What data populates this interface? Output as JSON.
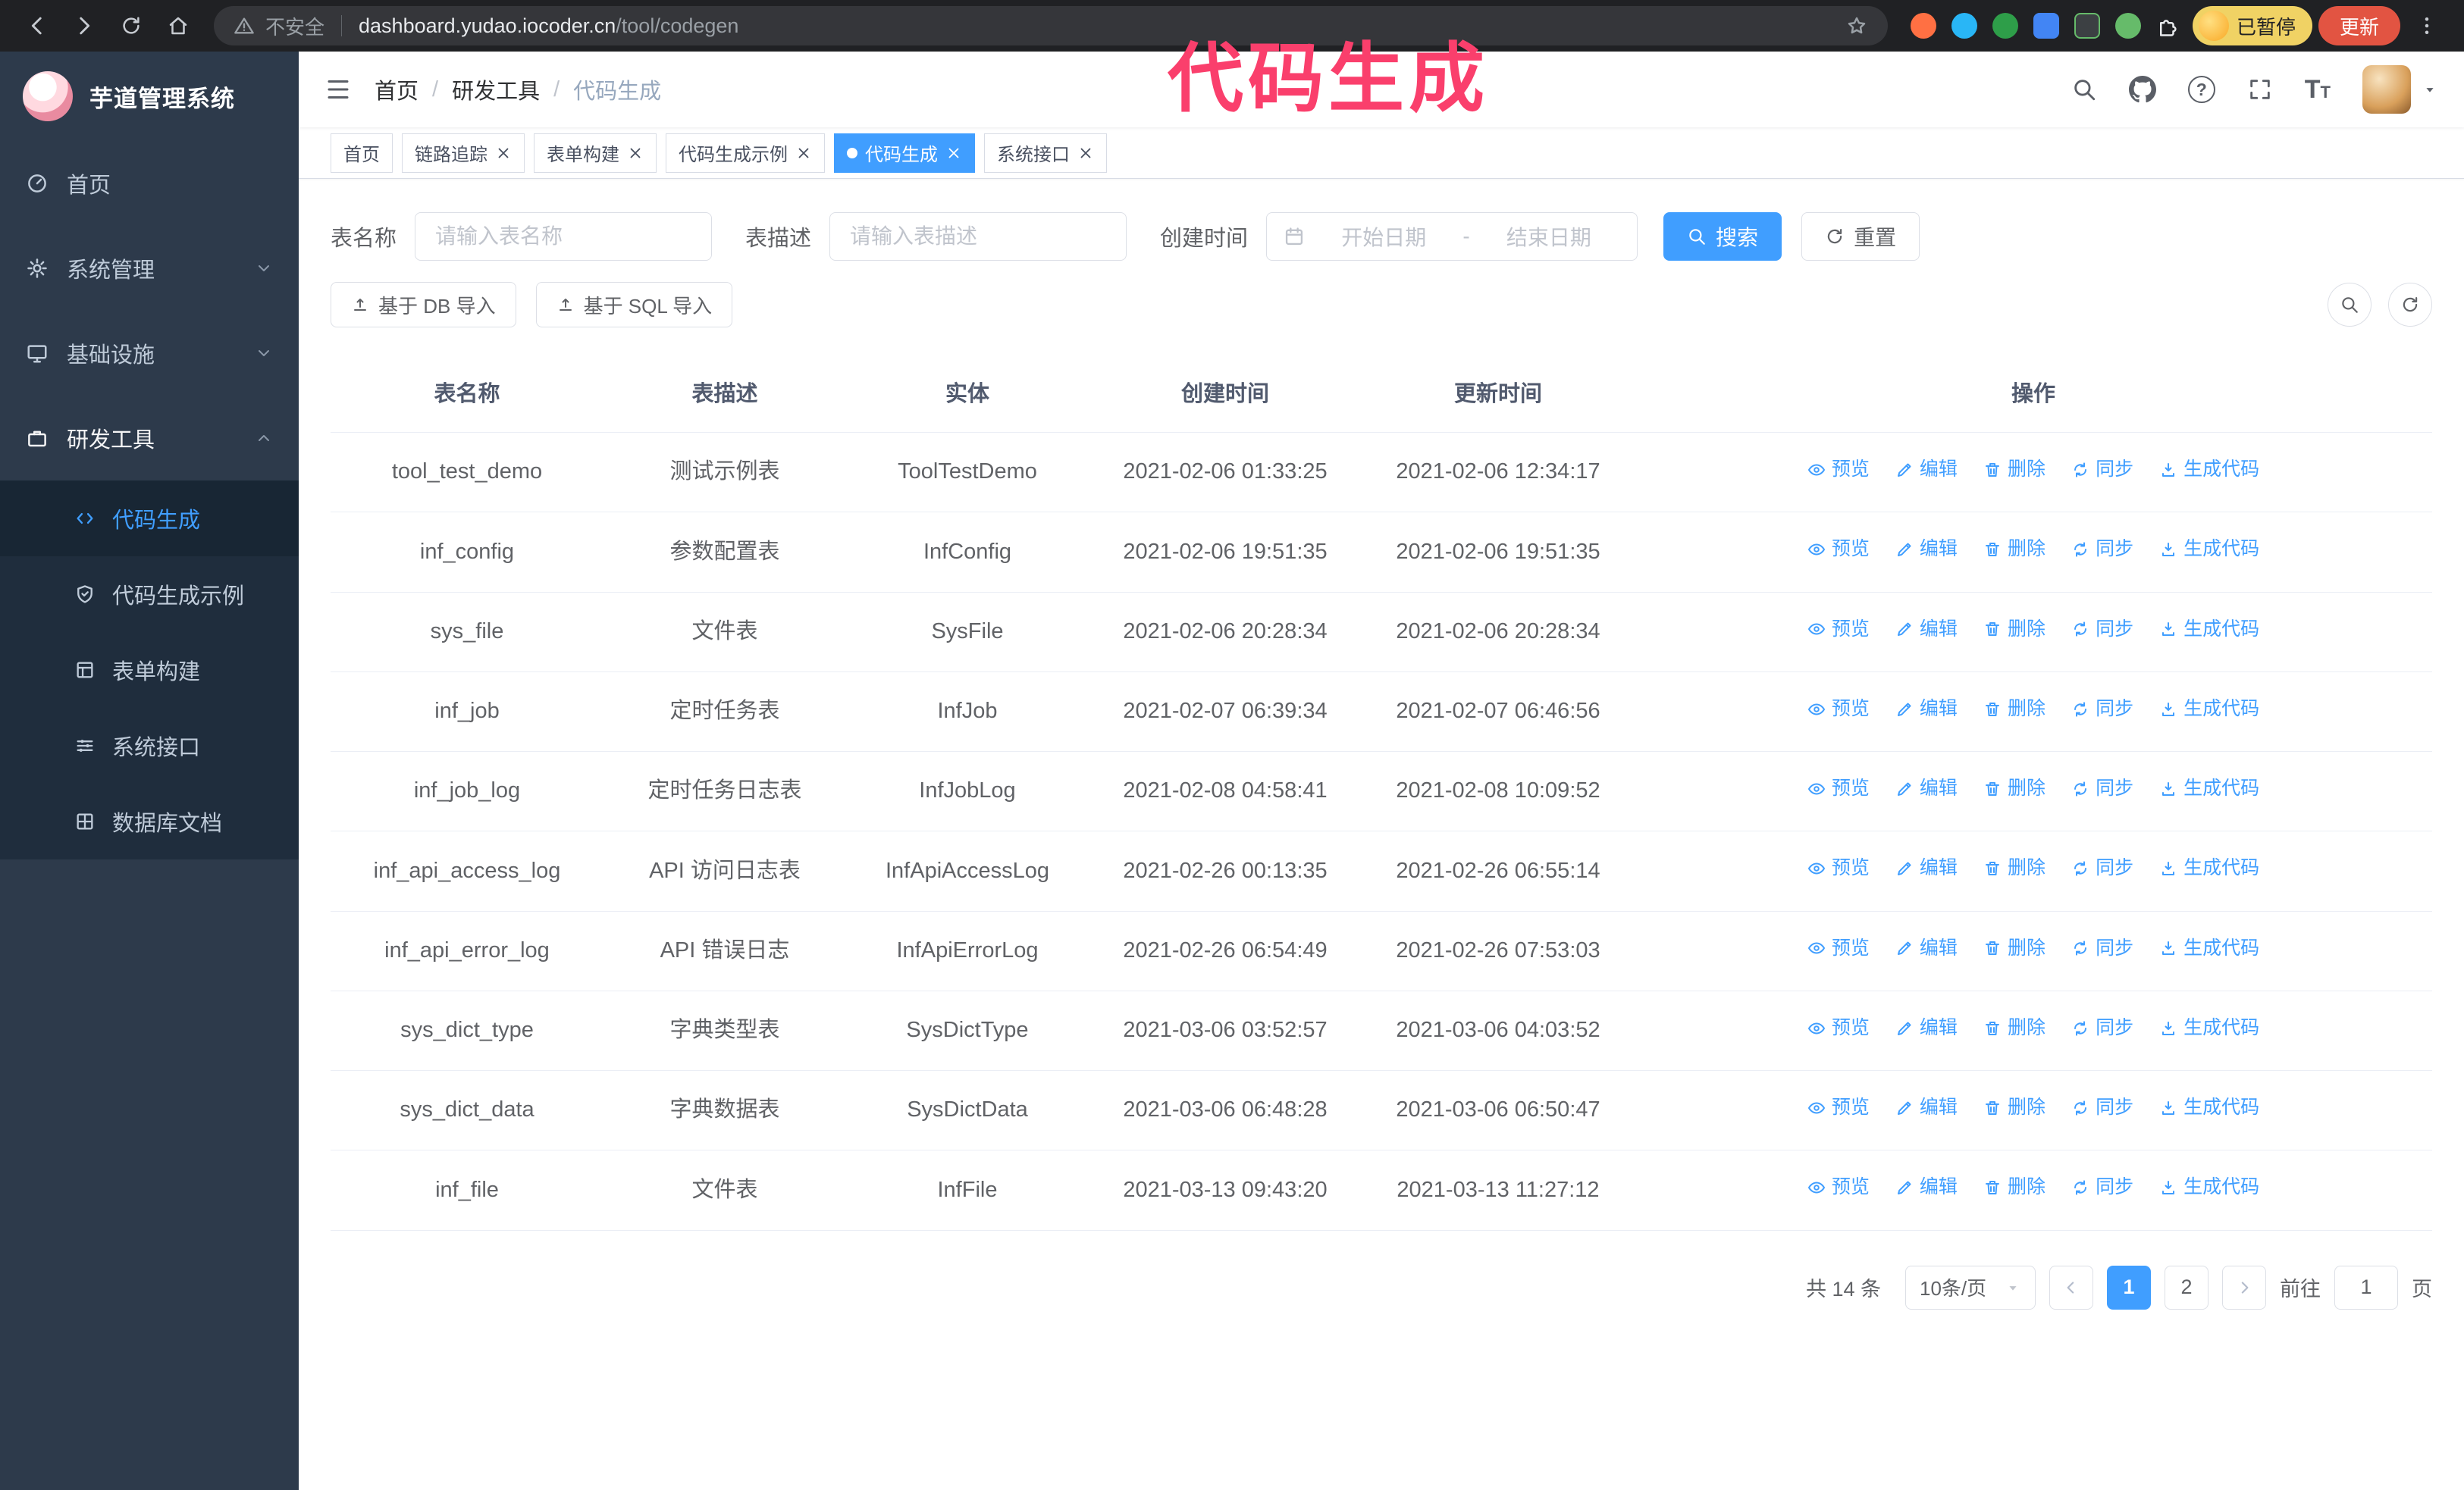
{
  "annotation": {
    "text": "代码生成"
  },
  "colors": {
    "primary_blue": "#409eff",
    "sidebar_bg": "#2d3a4b",
    "annotation_pink": "#fa3f6c",
    "update_button_red": "#e25442",
    "paused_chip_yellow": "#f0d264"
  },
  "browser": {
    "security_label": "不安全",
    "url_host": "dashboard.yudao.iocoder.cn",
    "url_path": "/tool/codegen",
    "paused_chip": "已暂停",
    "update_button": "更新"
  },
  "sidebar": {
    "logo_title": "芋道管理系统",
    "items": [
      {
        "label": "首页"
      },
      {
        "label": "系统管理"
      },
      {
        "label": "基础设施"
      },
      {
        "label": "研发工具"
      }
    ],
    "sub_items": [
      {
        "label": "代码生成"
      },
      {
        "label": "代码生成示例"
      },
      {
        "label": "表单构建"
      },
      {
        "label": "系统接口"
      },
      {
        "label": "数据库文档"
      }
    ]
  },
  "header": {
    "breadcrumb": [
      "首页",
      "研发工具",
      "代码生成"
    ],
    "separator": "/"
  },
  "tabs": [
    {
      "label": "首页"
    },
    {
      "label": "链路追踪"
    },
    {
      "label": "表单构建"
    },
    {
      "label": "代码生成示例"
    },
    {
      "label": "代码生成"
    },
    {
      "label": "系统接口"
    }
  ],
  "filters": {
    "table_name_label": "表名称",
    "table_name_placeholder": "请输入表名称",
    "table_desc_label": "表描述",
    "table_desc_placeholder": "请输入表描述",
    "create_time_label": "创建时间",
    "date_start_placeholder": "开始日期",
    "date_separator": "-",
    "date_end_placeholder": "结束日期",
    "search_button": "搜索",
    "reset_button": "重置"
  },
  "toolbar": {
    "import_db": "基于 DB 导入",
    "import_sql": "基于 SQL 导入"
  },
  "table": {
    "columns": [
      "表名称",
      "表描述",
      "实体",
      "创建时间",
      "更新时间",
      "操作"
    ],
    "actions": [
      "预览",
      "编辑",
      "删除",
      "同步",
      "生成代码"
    ],
    "rows": [
      {
        "name": "tool_test_demo",
        "desc": "测试示例表",
        "entity": "ToolTestDemo",
        "create_time": "2021-02-06 01:33:25",
        "update_time": "2021-02-06 12:34:17"
      },
      {
        "name": "inf_config",
        "desc": "参数配置表",
        "entity": "InfConfig",
        "create_time": "2021-02-06 19:51:35",
        "update_time": "2021-02-06 19:51:35"
      },
      {
        "name": "sys_file",
        "desc": "文件表",
        "entity": "SysFile",
        "create_time": "2021-02-06 20:28:34",
        "update_time": "2021-02-06 20:28:34"
      },
      {
        "name": "inf_job",
        "desc": "定时任务表",
        "entity": "InfJob",
        "create_time": "2021-02-07 06:39:34",
        "update_time": "2021-02-07 06:46:56"
      },
      {
        "name": "inf_job_log",
        "desc": "定时任务日志表",
        "entity": "InfJobLog",
        "create_time": "2021-02-08 04:58:41",
        "update_time": "2021-02-08 10:09:52"
      },
      {
        "name": "inf_api_access_log",
        "desc": "API 访问日志表",
        "entity": "InfApiAccessLog",
        "create_time": "2021-02-26 00:13:35",
        "update_time": "2021-02-26 06:55:14"
      },
      {
        "name": "inf_api_error_log",
        "desc": "API 错误日志",
        "entity": "InfApiErrorLog",
        "create_time": "2021-02-26 06:54:49",
        "update_time": "2021-02-26 07:53:03"
      },
      {
        "name": "sys_dict_type",
        "desc": "字典类型表",
        "entity": "SysDictType",
        "create_time": "2021-03-06 03:52:57",
        "update_time": "2021-03-06 04:03:52"
      },
      {
        "name": "sys_dict_data",
        "desc": "字典数据表",
        "entity": "SysDictData",
        "create_time": "2021-03-06 06:48:28",
        "update_time": "2021-03-06 06:50:47"
      },
      {
        "name": "inf_file",
        "desc": "文件表",
        "entity": "InfFile",
        "create_time": "2021-03-13 09:43:20",
        "update_time": "2021-03-13 11:27:12"
      }
    ]
  },
  "pagination": {
    "total": "共 14 条",
    "page_size": "10条/页",
    "pages": [
      "1",
      "2"
    ],
    "goto_label": "前往",
    "goto_value": "1",
    "goto_suffix": "页"
  }
}
